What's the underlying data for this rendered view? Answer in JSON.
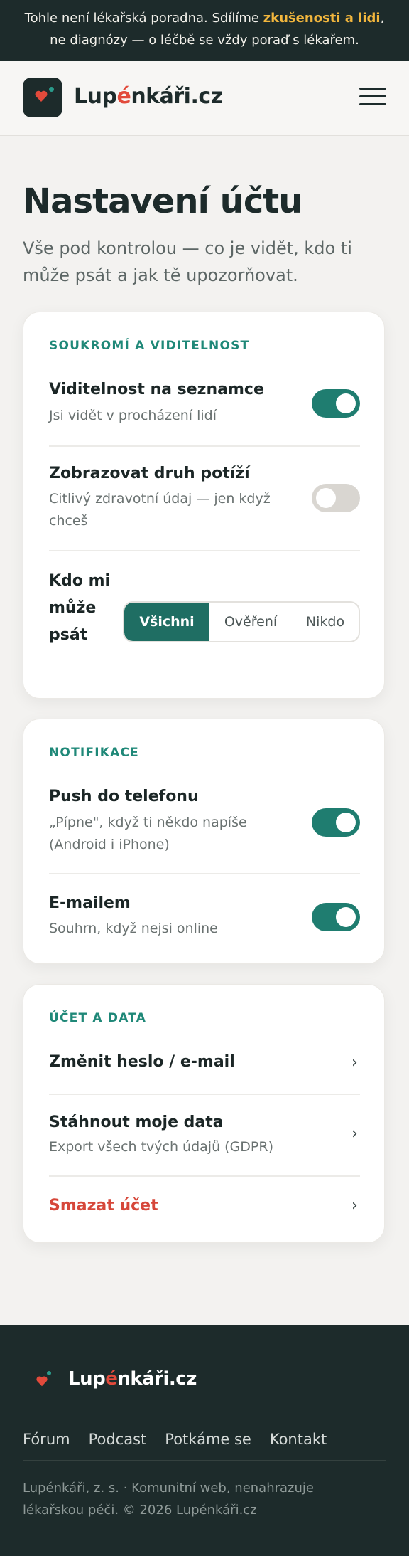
{
  "banner": {
    "text_before": "Tohle není lékařská poradna. Sdílíme ",
    "highlight": "zkušenosti a lidi",
    "text_after": ",",
    "line2": "ne diagnózy — o léčbě se vždy poraď s lékařem."
  },
  "header": {
    "brand_part1": "Lup",
    "brand_accent": "é",
    "brand_part2": "nkáři.cz"
  },
  "page": {
    "title": "Nastavení účtu",
    "subtitle": "Vše pod kontrolou — co je vidět, kdo ti může psát a jak tě upozorňovat."
  },
  "privacy": {
    "heading": "SOUKROMÍ A VIDITELNOST",
    "visibility": {
      "title": "Viditelnost na seznamce",
      "subtitle": "Jsi vidět v procházení lidí",
      "on": true
    },
    "condition": {
      "title": "Zobrazovat druh potíží",
      "subtitle": "Citlivý zdravotní údaj — jen když chceš",
      "on": false
    },
    "who_can_write": {
      "label": "Kdo mi může psát",
      "options": [
        "Všichni",
        "Ověření",
        "Nikdo"
      ],
      "selected": "Všichni"
    }
  },
  "notifications": {
    "heading": "NOTIFIKACE",
    "push": {
      "title": "Push do telefonu",
      "subtitle": "„Pípne\", když ti někdo napíše (Android i iPhone)",
      "on": true
    },
    "email": {
      "title": "E-mailem",
      "subtitle": "Souhrn, když nejsi online",
      "on": true
    }
  },
  "account": {
    "heading": "ÚČET A DATA",
    "change": {
      "title": "Změnit heslo / e-mail"
    },
    "download": {
      "title": "Stáhnout moje data",
      "subtitle": "Export všech tvých údajů (GDPR)"
    },
    "delete": {
      "title": "Smazat účet"
    },
    "chevron": "›"
  },
  "footer": {
    "brand_part1": "Lup",
    "brand_accent": "é",
    "brand_part2": "nkáři.cz",
    "links": [
      "Fórum",
      "Podcast",
      "Potkáme se",
      "Kontakt"
    ],
    "copyright": "Lupénkáři, z. s. · Komunitní web, nenahrazuje lékařskou péči. © 2026 Lupénkáři.cz"
  },
  "colors": {
    "accent": "#1f7d70",
    "brand_red": "#e24a3b",
    "dark": "#1d2b2b",
    "highlight": "#f2b63d"
  }
}
